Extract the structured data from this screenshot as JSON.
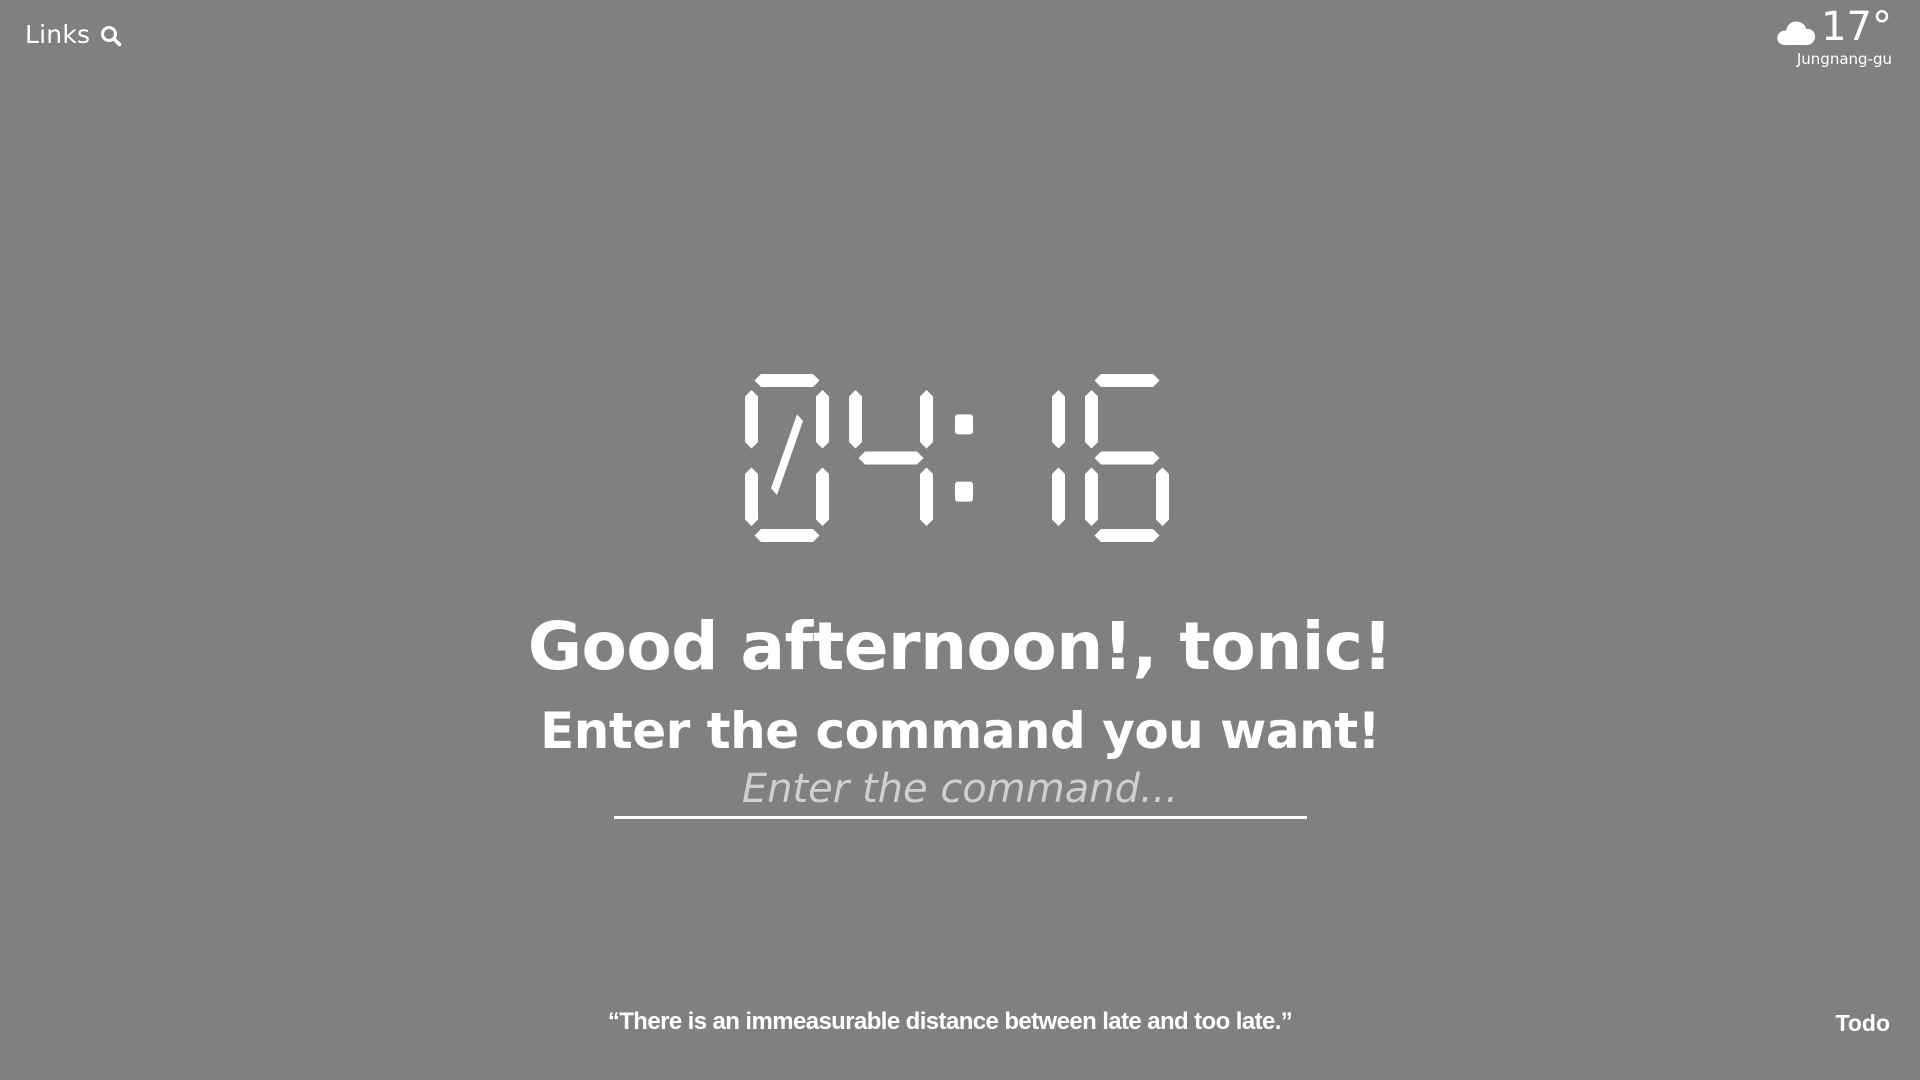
{
  "links": {
    "label": "Links",
    "search_icon": "search-icon"
  },
  "weather": {
    "icon": "cloud-icon",
    "temperature": "17°",
    "location": "Jungnang-gu"
  },
  "clock": {
    "time": "04:16"
  },
  "greeting": {
    "text": "Good afternoon!, tonic!"
  },
  "command": {
    "prompt": "Enter the command you want!",
    "placeholder": "Enter the command...",
    "value": ""
  },
  "quote": {
    "text": "“There is an immeasurable distance between late and too late.”"
  },
  "todo": {
    "label": "Todo"
  },
  "colors": {
    "background": "#808080",
    "foreground": "#ffffff"
  }
}
